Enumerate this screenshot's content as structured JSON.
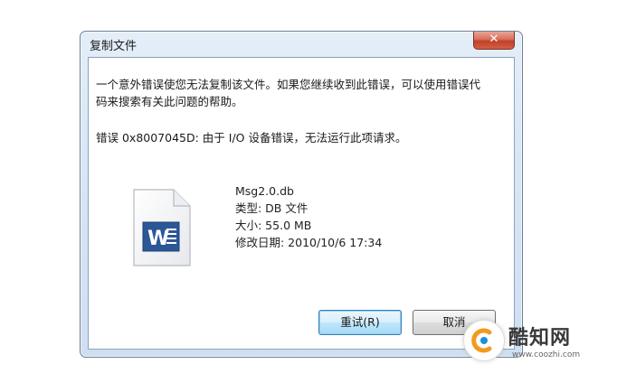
{
  "window": {
    "title": "复制文件",
    "close_glyph": "✕"
  },
  "message": {
    "line1": "一个意外错误使您无法复制该文件。如果您继续收到此错误，可以使用错误代",
    "line2": "码来搜索有关此问题的帮助。",
    "error": "错误 0x8007045D: 由于 I/O 设备错误，无法运行此项请求。"
  },
  "file": {
    "icon": "word-document-icon",
    "name": "Msg2.0.db",
    "type": "类型: DB 文件",
    "size": "大小: 55.0 MB",
    "modified": "修改日期: 2010/10/6 17:34"
  },
  "buttons": {
    "retry": "重试(R)",
    "cancel": "取消"
  },
  "watermark": {
    "brand": "酷知网",
    "url": "www.coozhi.com"
  },
  "colors": {
    "frame": "#d8e6f6",
    "close": "#c1412a",
    "primary_button": "#bee6fd",
    "word_blue": "#2b5797"
  }
}
